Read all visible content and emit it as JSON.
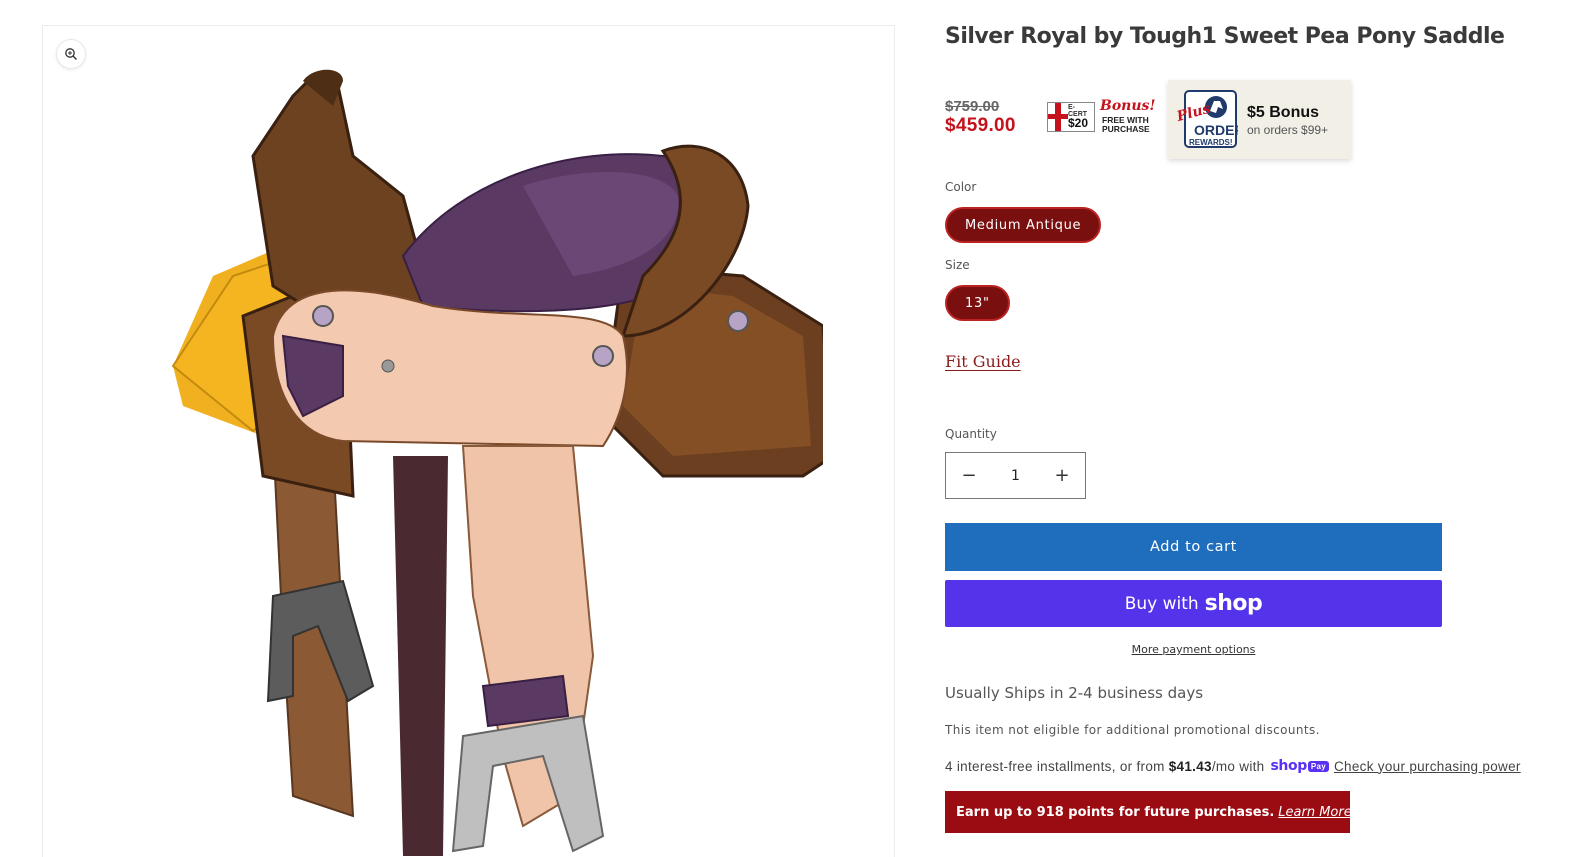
{
  "product": {
    "title": "Silver Royal by Tough1 Sweet Pea Pony Saddle",
    "image_alt": "Silver Royal Sweet Pea Pony Saddle"
  },
  "price": {
    "compare_at": "$759.00",
    "sale": "$459.00"
  },
  "bonus_badge": {
    "ecert_label": "E-CERT",
    "ecert_amount": "$20",
    "bonus_word": "Bonus!",
    "free_line1": "FREE WITH",
    "free_line2": "PURCHASE"
  },
  "rewards_card": {
    "logo_plus": "Plus",
    "logo_order": "ORDER",
    "logo_rewards": "REWARDS!",
    "title": "$5 Bonus",
    "subtitle": "on orders $99+"
  },
  "options": {
    "color_label": "Color",
    "color_value": "Medium Antique",
    "size_label": "Size",
    "size_value": "13\""
  },
  "fit_guide": "Fit Guide",
  "quantity": {
    "label": "Quantity",
    "value": "1",
    "decrease_symbol": "−",
    "increase_symbol": "+"
  },
  "buttons": {
    "add_to_cart": "Add to cart",
    "buy_with": "Buy with",
    "shop": "shop",
    "more_payment": "More payment options"
  },
  "shipping": "Usually Ships in 2-4 business days",
  "promo_note": "This item not eligible for additional promotional discounts.",
  "installments": {
    "prefix": "4 interest-free installments, or from",
    "amount": "$41.43",
    "suffix": "/mo with",
    "shop_text": "shop",
    "pay_text": "Pay",
    "link": "Check your purchasing power"
  },
  "points_bar": {
    "text": "Earn up to 918 points for future purchases.",
    "link": "Learn More"
  },
  "colors": {
    "price_red": "#c4131d",
    "pill_bg": "#7a0f0f",
    "cart_blue": "#1e6ebd",
    "shop_purple": "#5433eb",
    "points_bg": "#9b0c12"
  }
}
